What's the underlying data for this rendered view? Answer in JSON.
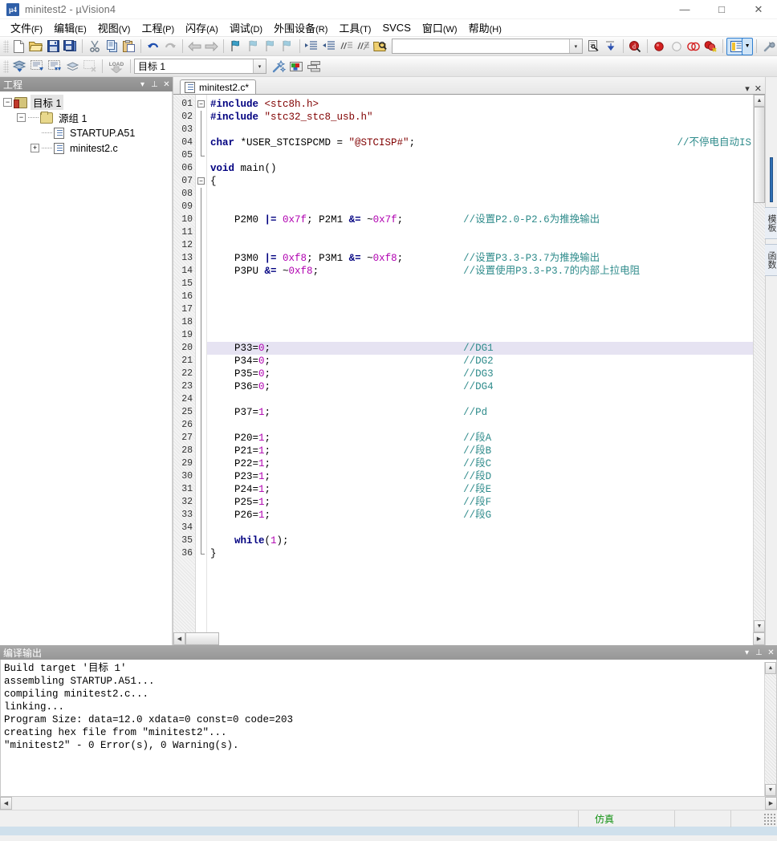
{
  "window": {
    "app_icon_text": "µ4",
    "title": "minitest2  -  µVision4",
    "minimize": "—",
    "maximize": "□",
    "close": "✕"
  },
  "menubar": {
    "items": [
      {
        "label": "文件",
        "mnemonic": "(F)"
      },
      {
        "label": "编辑",
        "mnemonic": "(E)"
      },
      {
        "label": "视图",
        "mnemonic": "(V)"
      },
      {
        "label": "工程",
        "mnemonic": "(P)"
      },
      {
        "label": "闪存",
        "mnemonic": "(A)"
      },
      {
        "label": "调试",
        "mnemonic": "(D)"
      },
      {
        "label": "外围设备",
        "mnemonic": "(R)"
      },
      {
        "label": "工具",
        "mnemonic": "(T)"
      },
      {
        "label": "SVCS",
        "mnemonic": ""
      },
      {
        "label": "窗口",
        "mnemonic": "(W)"
      },
      {
        "label": "帮助",
        "mnemonic": "(H)"
      }
    ]
  },
  "toolbar_main": {
    "buttons": [
      {
        "name": "new-file-icon",
        "glyph": "📄"
      },
      {
        "name": "open-file-icon",
        "glyph": "📂"
      },
      {
        "name": "save-icon",
        "glyph": "💾"
      },
      {
        "name": "save-all-icon",
        "glyph": "🗄"
      },
      {
        "name": "cut-icon",
        "glyph": "✂"
      },
      {
        "name": "copy-icon",
        "glyph": "⧉"
      },
      {
        "name": "paste-icon",
        "glyph": "📋"
      },
      {
        "name": "undo-icon",
        "glyph": "↶"
      },
      {
        "name": "redo-icon",
        "glyph": "↷"
      },
      {
        "name": "navigate-back-icon",
        "glyph": "⇦"
      },
      {
        "name": "navigate-forward-icon",
        "glyph": "⇨"
      },
      {
        "name": "bookmark-toggle-icon",
        "glyph": "🏳"
      },
      {
        "name": "bookmark-prev-icon",
        "glyph": "🏴"
      },
      {
        "name": "bookmark-next-icon",
        "glyph": "🏴"
      },
      {
        "name": "bookmark-clear-icon",
        "glyph": "🏴"
      },
      {
        "name": "indent-icon",
        "glyph": "⇥"
      },
      {
        "name": "outdent-icon",
        "glyph": "⇤"
      },
      {
        "name": "comment-icon",
        "glyph": "//≡"
      },
      {
        "name": "uncomment-icon",
        "glyph": "//≢"
      },
      {
        "name": "find-in-files-icon",
        "glyph": "🔍"
      }
    ],
    "find_placeholder": "",
    "find_value": "",
    "right_buttons": [
      {
        "name": "find-next-icon",
        "glyph": "🔎"
      },
      {
        "name": "go-to-definition-icon",
        "glyph": "⤵"
      },
      {
        "name": "debug-start-icon",
        "glyph": "@"
      },
      {
        "name": "breakpoint-insert-icon",
        "glyph": "●"
      },
      {
        "name": "breakpoint-disable-icon",
        "glyph": "○"
      },
      {
        "name": "breakpoint-disable-all-icon",
        "glyph": "◍"
      },
      {
        "name": "breakpoint-kill-all-icon",
        "glyph": "◉"
      },
      {
        "name": "window-layout-icon",
        "glyph": "▤"
      },
      {
        "name": "layout-dropdown-arrow-icon",
        "glyph": "▾"
      },
      {
        "name": "configure-icon",
        "glyph": "🔧"
      }
    ]
  },
  "toolbar_build": {
    "buttons": [
      {
        "name": "translate-file-icon",
        "glyph": "⬙"
      },
      {
        "name": "build-target-icon",
        "glyph": "▦"
      },
      {
        "name": "rebuild-all-icon",
        "glyph": "▩"
      },
      {
        "name": "batch-build-icon",
        "glyph": "◈"
      },
      {
        "name": "stop-build-icon",
        "glyph": "▨"
      },
      {
        "name": "download-icon",
        "glyph": "LOAD"
      }
    ],
    "target_select_value": "目标 1",
    "target_select_arrow": "▾",
    "after_buttons": [
      {
        "name": "target-options-icon",
        "glyph": "✨"
      },
      {
        "name": "manage-project-items-icon",
        "glyph": "▣"
      },
      {
        "name": "manage-multi-project-icon",
        "glyph": "❐"
      }
    ]
  },
  "project_pane": {
    "title": "工程",
    "header_buttons": [
      {
        "name": "pane-menu-icon",
        "glyph": "▾"
      },
      {
        "name": "pane-pin-icon",
        "glyph": "⊥"
      },
      {
        "name": "pane-close-icon",
        "glyph": "✕"
      }
    ],
    "tree": [
      {
        "label": "目标 1",
        "expander": "−",
        "icon": "target-icon",
        "depth": 0,
        "selected": true
      },
      {
        "label": "源组 1",
        "expander": "−",
        "icon": "folder-icon",
        "depth": 1,
        "selected": false
      },
      {
        "label": "STARTUP.A51",
        "expander": "",
        "icon": "source-file-icon",
        "depth": 2,
        "selected": false
      },
      {
        "label": "minitest2.c",
        "expander": "+",
        "icon": "source-file-icon",
        "depth": 2,
        "selected": false
      }
    ]
  },
  "editor": {
    "tab_label": "minitest2.c*",
    "tab_buttons": [
      {
        "name": "editor-menu-icon",
        "glyph": "▾"
      },
      {
        "name": "editor-close-icon",
        "glyph": "✕"
      }
    ],
    "current_line": 20,
    "lines": [
      {
        "n": "01",
        "fold": "box-minus",
        "tokens": [
          {
            "t": "#include ",
            "c": "pre"
          },
          {
            "t": "<stc8h.h>",
            "c": "inc"
          }
        ]
      },
      {
        "n": "02",
        "fold": "line",
        "tokens": [
          {
            "t": "#include ",
            "c": "pre"
          },
          {
            "t": "\"stc32_stc8_usb.h\"",
            "c": "str"
          }
        ]
      },
      {
        "n": "03",
        "fold": "line",
        "tokens": []
      },
      {
        "n": "04",
        "fold": "line",
        "tokens": [
          {
            "t": "char ",
            "c": "kw"
          },
          {
            "t": "*USER_STCISPCMD = ",
            "c": "id"
          },
          {
            "t": "\"@STCISP#\"",
            "c": "str"
          },
          {
            "t": ";",
            "c": "id"
          }
        ],
        "right_comment": "//不停电自动IS"
      },
      {
        "n": "05",
        "fold": "end",
        "tokens": []
      },
      {
        "n": "06",
        "fold": "",
        "tokens": [
          {
            "t": "void ",
            "c": "kw"
          },
          {
            "t": "main()",
            "c": "id"
          }
        ]
      },
      {
        "n": "07",
        "fold": "box-minus",
        "tokens": [
          {
            "t": "{",
            "c": "id"
          }
        ]
      },
      {
        "n": "08",
        "fold": "line",
        "tokens": []
      },
      {
        "n": "09",
        "fold": "line",
        "tokens": []
      },
      {
        "n": "10",
        "fold": "line",
        "tokens": [
          {
            "t": "    P2M0 ",
            "c": "id"
          },
          {
            "t": "|=",
            "c": "op"
          },
          {
            "t": " ",
            "c": "id"
          },
          {
            "t": "0x7f",
            "c": "num"
          },
          {
            "t": "; P2M1 ",
            "c": "id"
          },
          {
            "t": "&=",
            "c": "op"
          },
          {
            "t": " ~",
            "c": "id"
          },
          {
            "t": "0x7f",
            "c": "num"
          },
          {
            "t": ";",
            "c": "id"
          }
        ],
        "comment": "//设置P2.0-P2.6为推挽输出"
      },
      {
        "n": "11",
        "fold": "line",
        "tokens": []
      },
      {
        "n": "12",
        "fold": "line",
        "tokens": []
      },
      {
        "n": "13",
        "fold": "line",
        "tokens": [
          {
            "t": "    P3M0 ",
            "c": "id"
          },
          {
            "t": "|=",
            "c": "op"
          },
          {
            "t": " ",
            "c": "id"
          },
          {
            "t": "0xf8",
            "c": "num"
          },
          {
            "t": "; P3M1 ",
            "c": "id"
          },
          {
            "t": "&=",
            "c": "op"
          },
          {
            "t": " ~",
            "c": "id"
          },
          {
            "t": "0xf8",
            "c": "num"
          },
          {
            "t": ";",
            "c": "id"
          }
        ],
        "comment": "//设置P3.3-P3.7为推挽输出"
      },
      {
        "n": "14",
        "fold": "line",
        "tokens": [
          {
            "t": "    P3PU ",
            "c": "id"
          },
          {
            "t": "&=",
            "c": "op"
          },
          {
            "t": " ~",
            "c": "id"
          },
          {
            "t": "0xf8",
            "c": "num"
          },
          {
            "t": ";",
            "c": "id"
          }
        ],
        "comment": "//设置使用P3.3-P3.7的内部上拉电阻"
      },
      {
        "n": "15",
        "fold": "line",
        "tokens": []
      },
      {
        "n": "16",
        "fold": "line",
        "tokens": []
      },
      {
        "n": "17",
        "fold": "line",
        "tokens": []
      },
      {
        "n": "18",
        "fold": "line",
        "tokens": []
      },
      {
        "n": "19",
        "fold": "line",
        "tokens": []
      },
      {
        "n": "20",
        "fold": "line",
        "tokens": [
          {
            "t": "    P33=",
            "c": "id"
          },
          {
            "t": "0",
            "c": "num"
          },
          {
            "t": ";",
            "c": "id"
          }
        ],
        "comment": "//DG1"
      },
      {
        "n": "21",
        "fold": "line",
        "tokens": [
          {
            "t": "    P34=",
            "c": "id"
          },
          {
            "t": "0",
            "c": "num"
          },
          {
            "t": ";",
            "c": "id"
          }
        ],
        "comment": "//DG2"
      },
      {
        "n": "22",
        "fold": "line",
        "tokens": [
          {
            "t": "    P35=",
            "c": "id"
          },
          {
            "t": "0",
            "c": "num"
          },
          {
            "t": ";",
            "c": "id"
          }
        ],
        "comment": "//DG3"
      },
      {
        "n": "23",
        "fold": "line",
        "tokens": [
          {
            "t": "    P36=",
            "c": "id"
          },
          {
            "t": "0",
            "c": "num"
          },
          {
            "t": ";",
            "c": "id"
          }
        ],
        "comment": "//DG4"
      },
      {
        "n": "24",
        "fold": "line",
        "tokens": []
      },
      {
        "n": "25",
        "fold": "line",
        "tokens": [
          {
            "t": "    P37=",
            "c": "id"
          },
          {
            "t": "1",
            "c": "num"
          },
          {
            "t": ";",
            "c": "id"
          }
        ],
        "comment": "//Pd"
      },
      {
        "n": "26",
        "fold": "line",
        "tokens": []
      },
      {
        "n": "27",
        "fold": "line",
        "tokens": [
          {
            "t": "    P20=",
            "c": "id"
          },
          {
            "t": "1",
            "c": "num"
          },
          {
            "t": ";",
            "c": "id"
          }
        ],
        "comment": "//段A"
      },
      {
        "n": "28",
        "fold": "line",
        "tokens": [
          {
            "t": "    P21=",
            "c": "id"
          },
          {
            "t": "1",
            "c": "num"
          },
          {
            "t": ";",
            "c": "id"
          }
        ],
        "comment": "//段B"
      },
      {
        "n": "29",
        "fold": "line",
        "tokens": [
          {
            "t": "    P22=",
            "c": "id"
          },
          {
            "t": "1",
            "c": "num"
          },
          {
            "t": ";",
            "c": "id"
          }
        ],
        "comment": "//段C"
      },
      {
        "n": "30",
        "fold": "line",
        "tokens": [
          {
            "t": "    P23=",
            "c": "id"
          },
          {
            "t": "1",
            "c": "num"
          },
          {
            "t": ";",
            "c": "id"
          }
        ],
        "comment": "//段D"
      },
      {
        "n": "31",
        "fold": "line",
        "tokens": [
          {
            "t": "    P24=",
            "c": "id"
          },
          {
            "t": "1",
            "c": "num"
          },
          {
            "t": ";",
            "c": "id"
          }
        ],
        "comment": "//段E"
      },
      {
        "n": "32",
        "fold": "line",
        "tokens": [
          {
            "t": "    P25=",
            "c": "id"
          },
          {
            "t": "1",
            "c": "num"
          },
          {
            "t": ";",
            "c": "id"
          }
        ],
        "comment": "//段F"
      },
      {
        "n": "33",
        "fold": "line",
        "tokens": [
          {
            "t": "    P26=",
            "c": "id"
          },
          {
            "t": "1",
            "c": "num"
          },
          {
            "t": ";",
            "c": "id"
          }
        ],
        "comment": "//段G"
      },
      {
        "n": "34",
        "fold": "line",
        "tokens": []
      },
      {
        "n": "35",
        "fold": "line",
        "tokens": [
          {
            "t": "    while",
            "c": "kw"
          },
          {
            "t": "(",
            "c": "id"
          },
          {
            "t": "1",
            "c": "num"
          },
          {
            "t": ");",
            "c": "id"
          }
        ]
      },
      {
        "n": "36",
        "fold": "end",
        "tokens": [
          {
            "t": "}",
            "c": "id"
          }
        ]
      }
    ]
  },
  "dock_tabs": [
    {
      "name": "dock-tab-accent",
      "label": ""
    },
    {
      "name": "dock-tab-templates",
      "label": "模板"
    },
    {
      "name": "dock-tab-functions",
      "label": "函数"
    }
  ],
  "build_pane": {
    "title": "编译输出",
    "header_buttons": [
      {
        "name": "build-pane-menu-icon",
        "glyph": "▾"
      },
      {
        "name": "build-pane-pin-icon",
        "glyph": "⊥"
      },
      {
        "name": "build-pane-close-icon",
        "glyph": "✕"
      }
    ],
    "lines": [
      "Build target '目标 1'",
      "assembling STARTUP.A51...",
      "compiling minitest2.c...",
      "linking...",
      "Program Size: data=12.0 xdata=0 const=0 code=203",
      "creating hex file from \"minitest2\"...",
      "\"minitest2\" - 0 Error(s), 0 Warning(s)."
    ]
  },
  "statusbar": {
    "left": "",
    "sim_label": "仿真",
    "sim_color": "#109010",
    "cell2": "",
    "cell3": ""
  },
  "colors": {
    "keyword": "#000080",
    "string": "#800000",
    "number": "#b000b0",
    "comment": "#2e8b8b",
    "current_line_highlight": "#e6e3f2",
    "accent": "#2f6fb5"
  }
}
